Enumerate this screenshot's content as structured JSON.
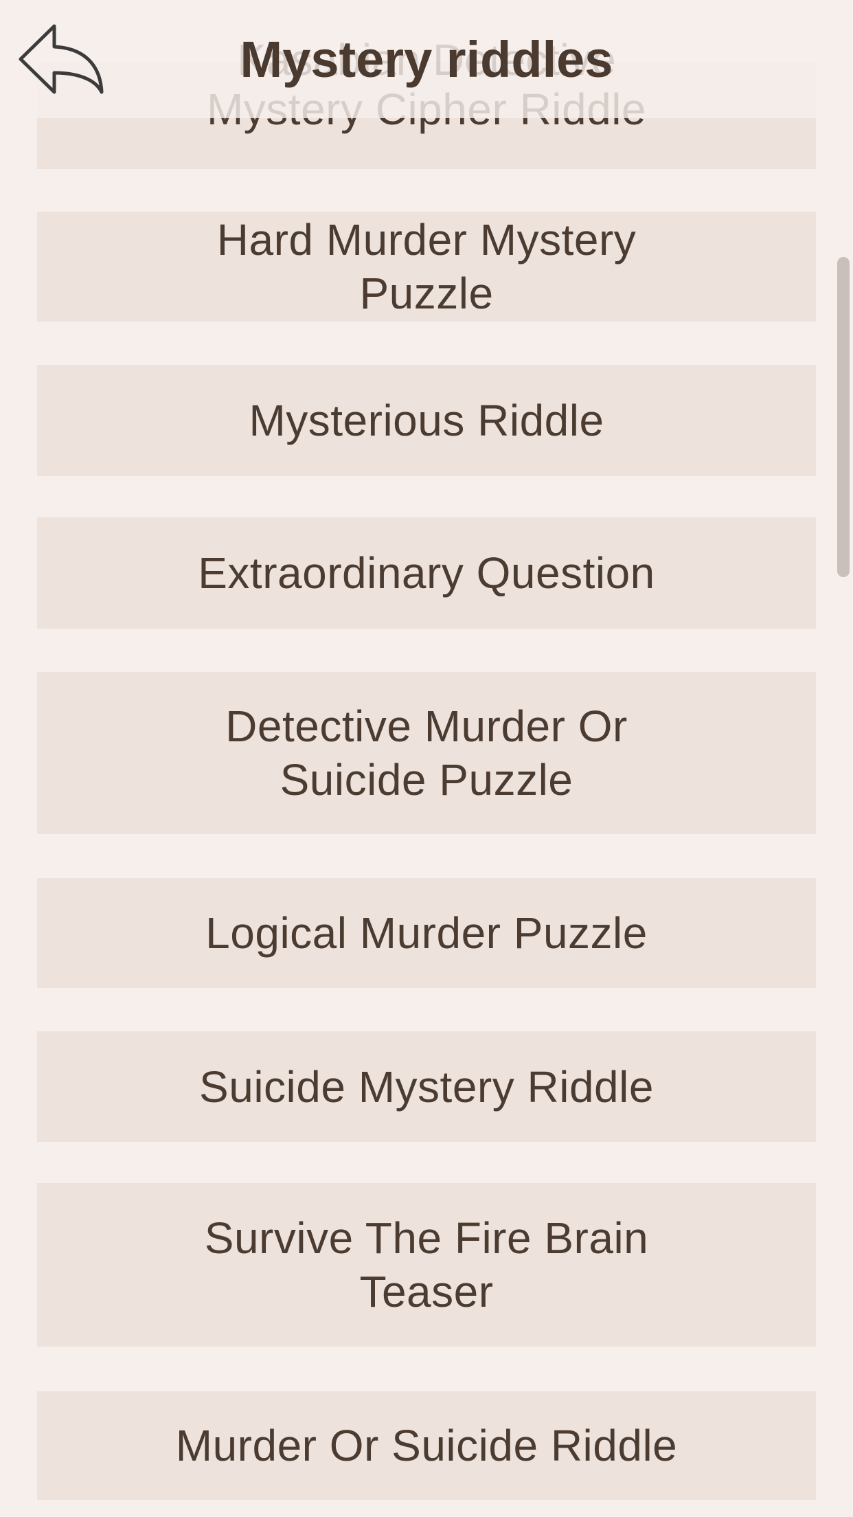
{
  "header": {
    "title": "Mystery riddles",
    "back_icon": "undo-arrow-icon",
    "ghost_lines": [
      "Kasabian Detective",
      "Mystery Cipher Riddle"
    ]
  },
  "list": {
    "items": [
      {
        "label": "Mystery Cipher Riddle",
        "partial": true
      },
      {
        "label": "Hard Murder Mystery Puzzle"
      },
      {
        "label": "Mysterious Riddle"
      },
      {
        "label": "Extraordinary Question"
      },
      {
        "label": "Detective Murder Or Suicide Puzzle"
      },
      {
        "label": "Logical Murder Puzzle"
      },
      {
        "label": "Suicide Mystery Riddle"
      },
      {
        "label": "Survive The Fire Brain Teaser"
      },
      {
        "label": "Murder Or Suicide Riddle"
      }
    ]
  },
  "colors": {
    "background": "#f6efeb",
    "item_background": "#ede3dc",
    "text": "#4b3b31",
    "title": "#4a3a2f",
    "scrollbar": "#c9c0bb"
  }
}
